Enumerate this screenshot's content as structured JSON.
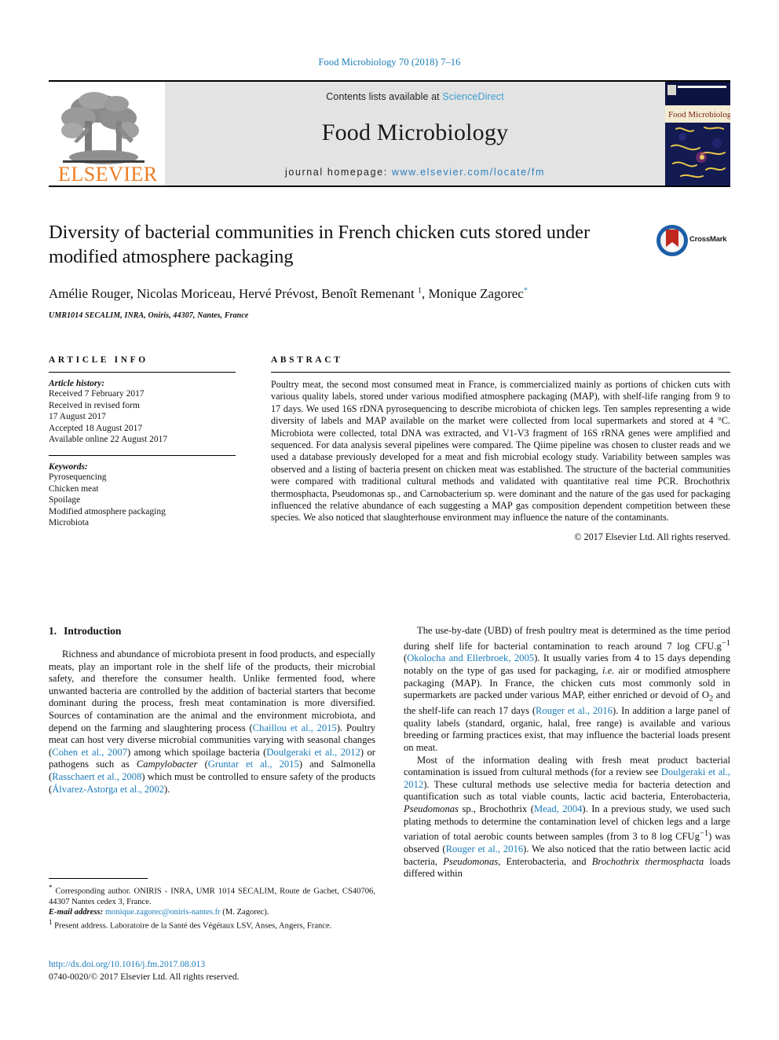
{
  "running_head": "Food Microbiology 70 (2018) 7–16",
  "masthead": {
    "contents_prefix": "Contents lists available at ",
    "contents_link": "ScienceDirect",
    "journal_name": "Food Microbiology",
    "homepage_label": "journal homepage: ",
    "homepage_url": "www.elsevier.com/locate/fm",
    "publisher_logo_text": "ELSEVIER",
    "cover_title": "Food Microbiology"
  },
  "title_block": {
    "title": "Diversity of bacterial communities in French chicken cuts stored under modified atmosphere packaging",
    "crossmark_label": "CrossMark",
    "authors_part1": "Amélie Rouger, Nicolas Moriceau, Hervé Prévost, Benoît Remenant ",
    "authors_sup1": "1",
    "authors_part2": ", Monique Zagorec",
    "authors_star": "*",
    "affiliation": "UMR1014 SECALIM, INRA, Oniris, 44307, Nantes, France"
  },
  "article_info": {
    "heading": "ARTICLE INFO",
    "history_label": "Article history:",
    "history_lines": [
      "Received 7 February 2017",
      "Received in revised form",
      "17 August 2017",
      "Accepted 18 August 2017",
      "Available online 22 August 2017"
    ],
    "keywords_label": "Keywords:",
    "keywords": [
      "Pyrosequencing",
      "Chicken meat",
      "Spoilage",
      "Modified atmosphere packaging",
      "Microbiota"
    ]
  },
  "abstract": {
    "heading": "ABSTRACT",
    "text": "Poultry meat, the second most consumed meat in France, is commercialized mainly as portions of chicken cuts with various quality labels, stored under various modified atmosphere packaging (MAP), with shelf-life ranging from 9 to 17 days. We used 16S rDNA pyrosequencing to describe microbiota of chicken legs. Ten samples representing a wide diversity of labels and MAP available on the market were collected from local supermarkets and stored at 4 °C. Microbiota were collected, total DNA was extracted, and V1-V3 fragment of 16S rRNA genes were amplified and sequenced. For data analysis several pipelines were compared. The Qiime pipeline was chosen to cluster reads and we used a database previously developed for a meat and fish microbial ecology study. Variability between samples was observed and a listing of bacteria present on chicken meat was established. The structure of the bacterial communities were compared with traditional cultural methods and validated with quantitative real time PCR. Brochothrix thermosphacta, Pseudomonas sp., and Carnobacterium sp. were dominant and the nature of the gas used for packaging influenced the relative abundance of each suggesting a MAP gas composition dependent competition between these species. We also noticed that slaughterhouse environment may influence the nature of the contaminants.",
    "copyright": "© 2017 Elsevier Ltd. All rights reserved."
  },
  "introduction": {
    "number": "1.",
    "title": "Introduction",
    "para1_a": "Richness and abundance of microbiota present in food products, and especially meats, play an important role in the shelf life of the products, their microbial safety, and therefore the consumer health. Unlike fermented food, where unwanted bacteria are controlled by the addition of bacterial starters that become dominant during the process, fresh meat contamination is more diversified. Sources of contamination are the animal and the environment microbiota, and depend on the farming and slaughtering process (",
    "cit_chaillou": "Chaillou et al., 2015",
    "para1_b": "). Poultry meat can host very diverse microbial communities varying with seasonal changes (",
    "cit_cohen": "Cohen et al., 2007",
    "para1_c": ") among which spoilage bacteria (",
    "cit_doulgeraki": "Doulgeraki et al., 2012",
    "para1_d": ") or pathogens such as ",
    "ital_campylobacter": "Campylobacter",
    "para1_e": " (",
    "cit_gruntar": "Gruntar et al., 2015",
    "para1_f": ") and Salmonella (",
    "cit_rasschaert": "Rasschaert et al., 2008",
    "para1_g": ") which must be controlled to ensure safety of the products (",
    "cit_alvarez": "Álvarez-Astorga et al., 2002",
    "para1_h": ")."
  },
  "right_column": {
    "para1_a": "The use-by-date (UBD) of fresh poultry meat is determined as the time period during shelf life for bacterial contamination to reach around 7 log CFU.g",
    "sup_minus1": "−1",
    "para1_b": " (",
    "cit_okolocha": "Okolocha and Ellerbroek, 2005",
    "para1_c": "). It usually varies from 4 to 15 days depending notably on the type of gas used for packaging, ",
    "ital_ie": "i.e.",
    "para1_d": " air or modified atmosphere packaging (MAP). In France, the chicken cuts most commonly sold in supermarkets are packed under various MAP, either enriched or devoid of O",
    "sub_2": "2",
    "para1_e": " and the shelf-life can reach 17 days (",
    "cit_rouger1": "Rouger et al., 2016",
    "para1_f": "). In addition a large panel of quality labels (standard, organic, halal, free range) is available and various breeding or farming practices exist, that may influence the bacterial loads present on meat.",
    "para2_a": "Most of the information dealing with fresh meat product bacterial contamination is issued from cultural methods (for a review see ",
    "cit_doulgeraki2": "Doulgeraki et al., 2012",
    "para2_b": "). These cultural methods use selective media for bacteria detection and quantification such as total viable counts, lactic acid bacteria, Enterobacteria, ",
    "ital_pseudomonas": "Pseudomonas",
    "para2_c": " sp., Brochothrix (",
    "cit_mead": "Mead, 2004",
    "para2_d": "). In a previous study, we used such plating methods to determine the contamination level of chicken legs and a large variation of total aerobic counts between samples (from 3 to 8 log CFUg",
    "sup_minus1b": "−1",
    "para2_e": ") was observed (",
    "cit_rouger2": "Rouger et al., 2016",
    "para2_f": "). We also noticed that the ratio between lactic acid bacteria, ",
    "ital_pseudomonas2": "Pseudomonas",
    "para2_g": ", Enterobacteria, and ",
    "ital_brochothrix": "Brochothrix thermosphacta",
    "para2_h": " loads differed within"
  },
  "footnotes": {
    "corresponding_mark": "*",
    "corresponding_text": " Corresponding author. ONIRIS - INRA, UMR 1014 SECALIM, Route de Gachet, CS40706, 44307 Nantes cedex 3, France.",
    "email_label": "E-mail address:",
    "email": "monique.zagorec@oniris-nantes.fr",
    "email_suffix": " (M. Zagorec).",
    "present_mark": "1",
    "present_text": " Present address. Laboratoire de la Santé des Végétaux LSV, Anses, Angers, France.",
    "doi": "http://dx.doi.org/10.1016/j.fm.2017.08.013",
    "issn": "0740-0020/© 2017 Elsevier Ltd. All rights reserved."
  },
  "colors": {
    "link_blue": "#1a7bb9",
    "sciencedirect_blue": "#3c9fd4",
    "elsevier_orange": "#ee7d23",
    "contents_gray": "#e3e3e3"
  }
}
